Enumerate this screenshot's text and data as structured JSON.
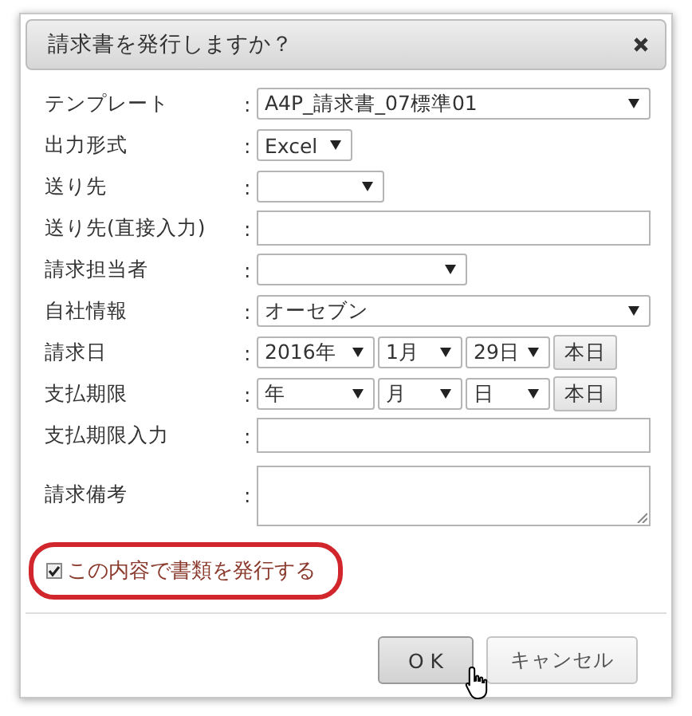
{
  "dialog": {
    "title": "請求書を発行しますか？"
  },
  "rows": [
    {
      "label": "テンプレート",
      "separator": ":",
      "kind": "select",
      "value": "A4P_請求書_07標準01"
    },
    {
      "label": "出力形式",
      "separator": ":",
      "kind": "select",
      "value": "Excel"
    },
    {
      "label": "送り先",
      "separator": ":",
      "kind": "select"
    },
    {
      "label": "送り先(直接入力)",
      "separator": ":",
      "kind": "input"
    },
    {
      "label": "請求担当者",
      "separator": ":",
      "kind": "select"
    },
    {
      "label": "自社情報",
      "separator": ":",
      "kind": "select",
      "value": "オーセブン"
    },
    {
      "label": "請求日",
      "separator": ":",
      "kind": "date",
      "parts": [
        "2016年",
        "1月",
        "29日"
      ],
      "button": "本日"
    },
    {
      "label": "支払期限",
      "separator": ":",
      "kind": "date",
      "parts": [
        "年",
        "月",
        "日"
      ],
      "button": "本日"
    },
    {
      "label": "支払期限入力",
      "separator": ":",
      "kind": "input"
    },
    {
      "label": "請求備考",
      "separator": ":",
      "kind": "textarea"
    }
  ],
  "confirm": {
    "label": "この内容で書類を発行する",
    "checked": true
  },
  "buttons": [
    {
      "label": "O K",
      "hovered": true
    },
    {
      "label": "キャンセル",
      "hovered": false
    }
  ]
}
